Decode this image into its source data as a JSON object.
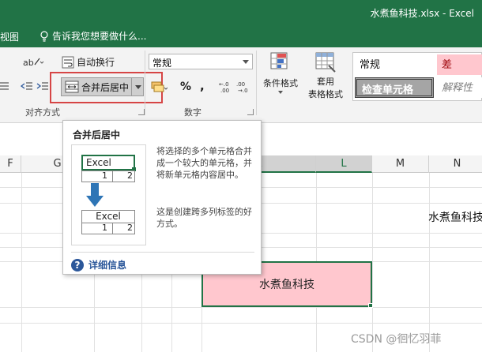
{
  "title_bar": {
    "title": "水煮鱼科技.xlsx - Excel"
  },
  "menu": {
    "view_tab": "视图",
    "tell_me": "告诉我您想要做什么..."
  },
  "ribbon": {
    "wrap_text": "自动换行",
    "merge_center": "合并后居中",
    "alignment_group": "对齐方式",
    "number_format": "常规",
    "percent": "%",
    "comma": ",",
    "number_group": "数字",
    "conditional_format": "条件格式",
    "format_as_table_line1": "套用",
    "format_as_table_line2": "表格格式",
    "styles": {
      "normal": "常规",
      "bad": "差",
      "check_cell": "检查单元格",
      "explanatory": "解释性"
    }
  },
  "columns": [
    "F",
    "G",
    "H",
    "I",
    "J",
    "K",
    "L",
    "M",
    "N"
  ],
  "tooltip": {
    "title": "合并后居中",
    "description": "将选择的多个单元格合并成一个较大的单元格，并将新单元格内容居中。",
    "description2": "这是创建跨多列标签的好方式。",
    "more_info": "详细信息",
    "illustration": {
      "top_label": "Excel",
      "bottom_label": "Excel",
      "num1": "1",
      "num2": "2"
    }
  },
  "cells": {
    "merged_text": "水煮鱼科技",
    "far_text": "水煮鱼科技"
  },
  "watermark": "CSDN @徊忆羽菲",
  "colors": {
    "title_green": "#217346",
    "style_bad_bg": "#ffc7ce",
    "style_bad_text": "#9c0006",
    "highlight_red": "#d64545"
  }
}
